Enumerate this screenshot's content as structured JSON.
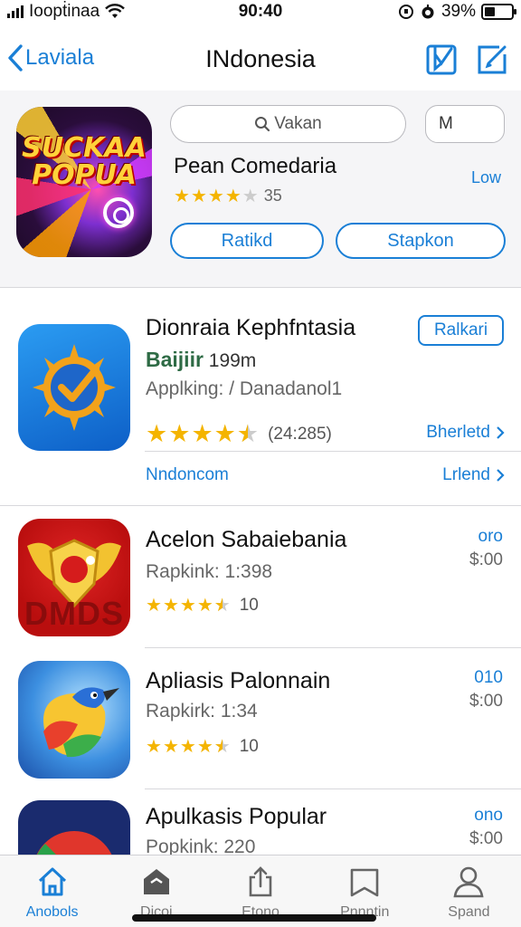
{
  "status_bar": {
    "carrier": "Ioopṫinaa",
    "time": "90:40",
    "battery": "39%",
    "battery_level": 0.39
  },
  "nav": {
    "back_label": "Laviala",
    "title": "INdonesia"
  },
  "featured": {
    "icon_text_line1": "SUCKAA",
    "icon_text_line2": "POPUA",
    "search_placeholder": "Vakan",
    "small_input_value": "M",
    "name": "Pean Comedaria",
    "rating": 4,
    "rating_count": "35",
    "side_link": "Low",
    "button_left": "Ratikd",
    "button_right": "Stapkon"
  },
  "apps": [
    {
      "title": "Dionraia Kephfntasia",
      "subtitle_bold": "Baijiir",
      "subtitle_size": "199m",
      "category": "Applking: / Danadanol1",
      "rating": 4.5,
      "rating_count": "(24:285)",
      "action_button": "Ralkari",
      "link_right": "Bherletd",
      "footer_left": "Nndoncom",
      "footer_right": "Lrlend"
    },
    {
      "title": "Acelon Sabaiebania",
      "subtitle": "Rapkink: 1:398",
      "rating": 4.5,
      "rating_count": "10",
      "price_top": "oro",
      "price": "$:00",
      "icon_text": "DMDS"
    },
    {
      "title": "Apliasis Palonnain",
      "subtitle": "Rapkirk: 1:34",
      "rating": 4.5,
      "rating_count": "10",
      "price_top": "010",
      "price": "$:00"
    },
    {
      "title": "Apulkasis Popular",
      "subtitle": "Popkink: 220",
      "price_top": "ono",
      "price": "$:00"
    }
  ],
  "tabs": [
    {
      "label": "Anobols",
      "icon": "home-icon",
      "active": true
    },
    {
      "label": "Dicoi",
      "icon": "store-icon",
      "active": false
    },
    {
      "label": "Etono",
      "icon": "share-icon",
      "active": false
    },
    {
      "label": "Pnnntin",
      "icon": "book-icon",
      "active": false
    },
    {
      "label": "Spand",
      "icon": "person-icon",
      "active": false
    }
  ],
  "colors": {
    "accent": "#1a7fd6",
    "star": "#f4b400",
    "header_bg": "#f5f5f7"
  }
}
